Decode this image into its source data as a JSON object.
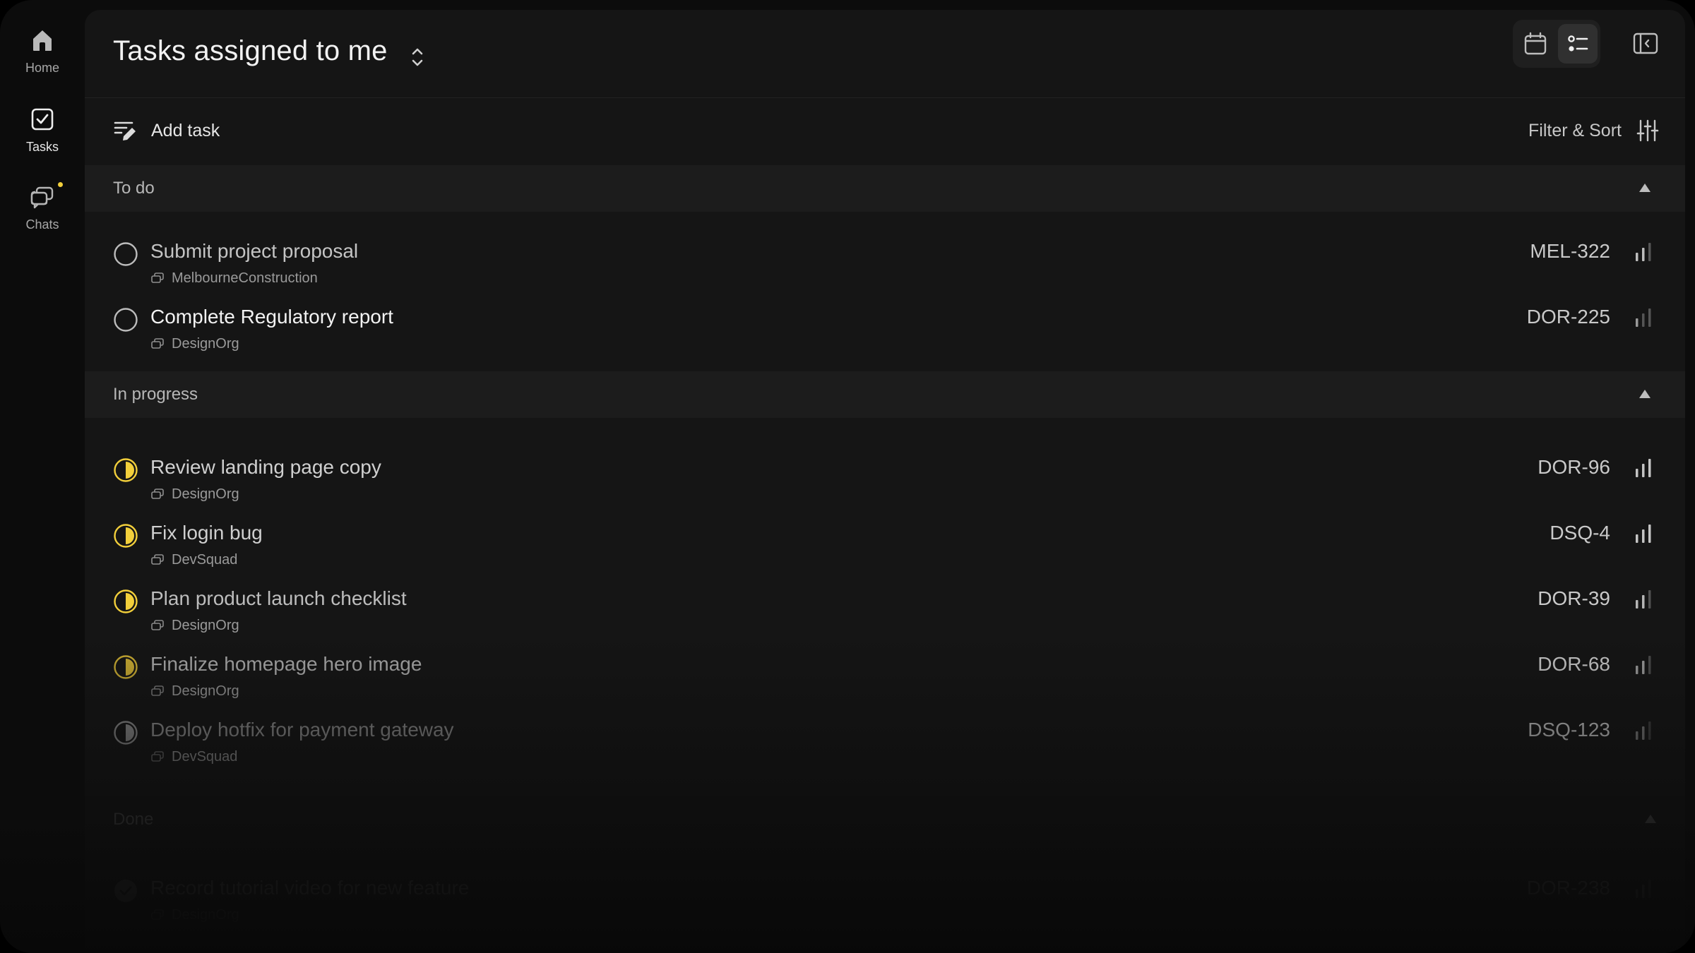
{
  "sidebar": {
    "items": [
      {
        "label": "Home",
        "icon": "home-icon"
      },
      {
        "label": "Tasks",
        "icon": "tasks-icon"
      },
      {
        "label": "Chats",
        "icon": "chats-icon"
      }
    ]
  },
  "header": {
    "title": "Tasks assigned to me"
  },
  "toolbar": {
    "add_task_label": "Add task",
    "filter_label": "Filter & Sort"
  },
  "colors": {
    "accent_yellow": "#f2cf3b",
    "background": "#0c0c0c",
    "panel": "#151515",
    "section_header": "#1c1c1c"
  },
  "sections": [
    {
      "label": "To do",
      "tasks": [
        {
          "title": "Submit project proposal",
          "workspace": "MelbourneConstruction",
          "id": "MEL-322",
          "status": "todo"
        },
        {
          "title": "Complete Regulatory report",
          "workspace": "DesignOrg",
          "id": "DOR-225",
          "status": "todo"
        }
      ]
    },
    {
      "label": "In progress",
      "tasks": [
        {
          "title": "Review landing page copy",
          "workspace": "DesignOrg",
          "id": "DOR-96",
          "status": "in-progress"
        },
        {
          "title": "Fix login bug",
          "workspace": "DevSquad",
          "id": "DSQ-4",
          "status": "in-progress"
        },
        {
          "title": "Plan product launch checklist",
          "workspace": "DesignOrg",
          "id": "DOR-39",
          "status": "in-progress"
        },
        {
          "title": "Finalize homepage hero image",
          "workspace": "DesignOrg",
          "id": "DOR-68",
          "status": "in-progress"
        },
        {
          "title": "Deploy hotfix for payment gateway",
          "workspace": "DevSquad",
          "id": "DSQ-123",
          "status": "in-progress"
        }
      ]
    },
    {
      "label": "Done",
      "tasks": [
        {
          "title": "Record tutorial video for new feature",
          "workspace": "DesignOrg",
          "id": "DOR-238",
          "status": "done"
        }
      ]
    }
  ]
}
